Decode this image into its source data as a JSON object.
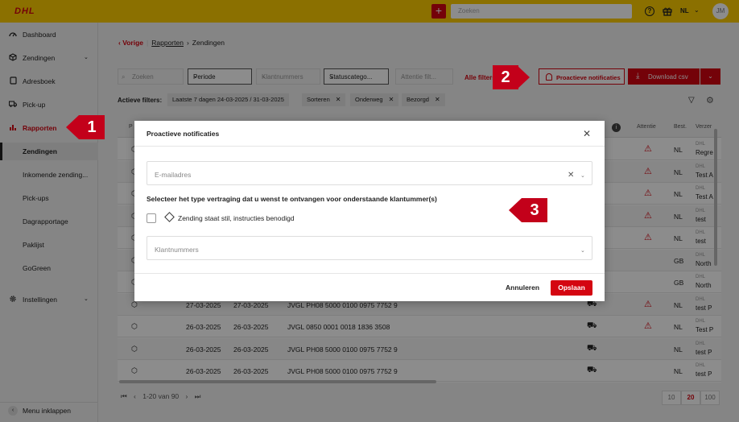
{
  "topbar": {
    "logo": "DHL",
    "add_label": "+",
    "search_placeholder": "Zoeken",
    "help_label": "?",
    "language": "NL",
    "avatar_initials": "JM"
  },
  "sidebar": {
    "items": [
      {
        "label": "Dashboard"
      },
      {
        "label": "Zendingen"
      },
      {
        "label": "Adresboek"
      },
      {
        "label": "Pick-up"
      },
      {
        "label": "Rapporten"
      },
      {
        "label": "Zendingen"
      },
      {
        "label": "Inkomende zending..."
      },
      {
        "label": "Pick-ups"
      },
      {
        "label": "Dagrapportage"
      },
      {
        "label": "Paklijst"
      },
      {
        "label": "GoGreen"
      },
      {
        "label": "Instellingen"
      }
    ],
    "collapse_label": "Menu inklappen"
  },
  "breadcrumb": {
    "back": "Vorige",
    "link": "Rapporten",
    "current": "Zendingen"
  },
  "filters": {
    "search_placeholder": "Zoeken",
    "periode": "Periode",
    "klantnummers": "Klantnummers",
    "statuscategorie": "Statuscatego...",
    "attentie": "Attentie filt...",
    "alle_filters": "Alle filters",
    "proactive_button": "Proactieve notificaties",
    "download_button": "Download csv"
  },
  "active_filters": {
    "label": "Actieve filters:",
    "chips": [
      "Laatste 7 dagen  24-03-2025 / 31-03-2025",
      "Sorteren",
      "Onderweg",
      "Bezorgd"
    ]
  },
  "table": {
    "headers": {
      "first": "P",
      "attentie": "Attentie",
      "bestemming": "Best.",
      "verzender": "Verzer"
    },
    "dhl_label": "DHL",
    "rows": [
      {
        "d1": "",
        "d2": "",
        "ref": "",
        "country": "NL",
        "name": "Regre",
        "warn": true
      },
      {
        "d1": "",
        "d2": "",
        "ref": "",
        "country": "NL",
        "name": "Test A",
        "warn": true
      },
      {
        "d1": "",
        "d2": "",
        "ref": "",
        "country": "NL",
        "name": "Test A",
        "warn": true
      },
      {
        "d1": "",
        "d2": "",
        "ref": "",
        "country": "NL",
        "name": "test",
        "warn": true
      },
      {
        "d1": "",
        "d2": "",
        "ref": "",
        "country": "NL",
        "name": "test",
        "warn": true
      },
      {
        "d1": "",
        "d2": "",
        "ref": "",
        "country": "GB",
        "name": "North",
        "warn": false
      },
      {
        "d1": "",
        "d2": "",
        "ref": "",
        "country": "GB",
        "name": "North",
        "warn": false
      },
      {
        "d1": "27-03-2025",
        "d2": "27-03-2025",
        "ref": "JVGL  PH08 5000 0100 0975 7752 9",
        "country": "NL",
        "name": "test P",
        "warn": true
      },
      {
        "d1": "26-03-2025",
        "d2": "26-03-2025",
        "ref": "JVGL  0850 0001 0018 1836 3508",
        "country": "NL",
        "name": "Test P",
        "warn": true
      },
      {
        "d1": "26-03-2025",
        "d2": "26-03-2025",
        "ref": "JVGL  PH08 5000 0100 0975 7752 9",
        "country": "NL",
        "name": "test P",
        "warn": false
      },
      {
        "d1": "26-03-2025",
        "d2": "26-03-2025",
        "ref": "JVGL  PH08 5000 0100 0975 7752 9",
        "country": "NL",
        "name": "test P",
        "warn": false
      }
    ]
  },
  "pager": {
    "range": "1-20 van 90",
    "first": "⏮",
    "prev": "‹",
    "next": "›",
    "last": "⏭",
    "sizes": [
      "10",
      "20",
      "100"
    ],
    "selected_size": "20"
  },
  "modal": {
    "title": "Proactieve notificaties",
    "email_placeholder": "E-mailadres",
    "select_title": "Selecteer het type vertraging dat u wenst te ontvangen voor onderstaande klantummer(s)",
    "option_label": "Zending staat stil, instructies benodigd",
    "klant_placeholder": "Klantnummers",
    "cancel": "Annuleren",
    "save": "Opslaan"
  },
  "callouts": [
    "1",
    "2",
    "3"
  ],
  "colors": {
    "brand_yellow": "#fdcc00",
    "brand_red": "#d40511",
    "callout_red": "#c3001a"
  }
}
